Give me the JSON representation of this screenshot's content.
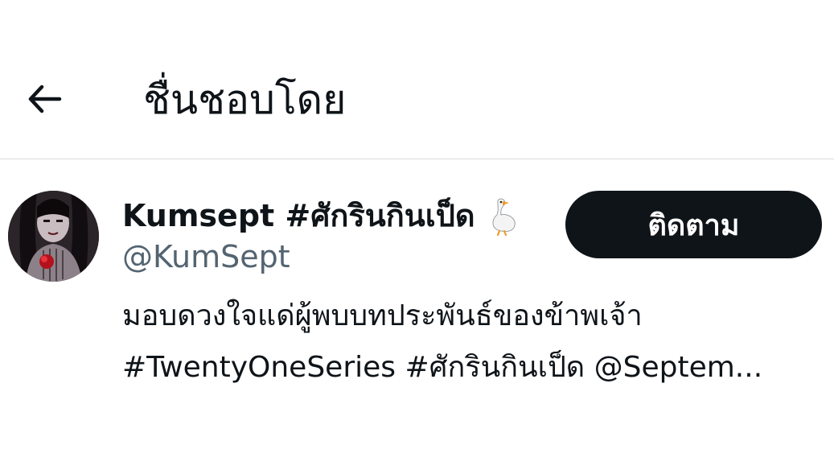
{
  "header": {
    "title": "ชื่นชอบโดย",
    "back_icon": "arrow-left-icon"
  },
  "user": {
    "display_name": "Kumsept #ศักรินกินเป็ด",
    "display_name_emoji": "goose-icon",
    "handle": "@KumSept",
    "bio_line1": "มอบดวงใจแด่ผู้พบบทประพันธ์ของข้าพเจ้า",
    "bio_line2": "#TwentyOneSeries #ศักรินกินเป็ด @Septem...",
    "follow_label": "ติดตาม"
  },
  "colors": {
    "text": "#0f1419",
    "secondary_text": "#536471",
    "button_bg": "#0f1419",
    "button_text": "#ffffff",
    "divider": "#d9dcdf"
  }
}
